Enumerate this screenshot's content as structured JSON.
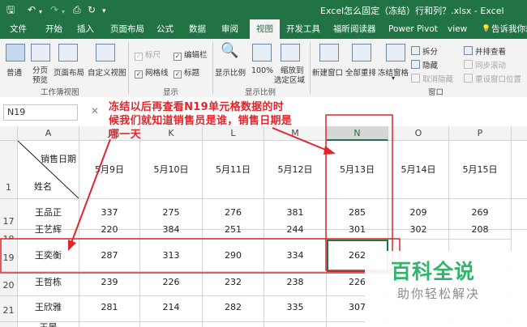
{
  "title": "Excel怎么固定（冻结）行和列？.xlsx - Excel",
  "quick_access": {
    "save_icon": "save-icon",
    "undo_icon": "undo-icon",
    "redo_icon": "redo-icon",
    "print_preview_icon": "print-preview-icon",
    "customize_icon": "customize-icon"
  },
  "tabs": [
    "文件",
    "开始",
    "插入",
    "页面布局",
    "公式",
    "数据",
    "审阅",
    "视图",
    "开发工具",
    "福昕阅读器",
    "Power Pivot",
    "view",
    "告诉我你想"
  ],
  "active_tab": "视图",
  "ribbon": {
    "workbook_views": {
      "normal": "普通",
      "page_break_1": "分页",
      "page_break_2": "预览",
      "page_layout": "页面布局",
      "custom": "自定义视图",
      "group": "工作簿视图"
    },
    "show": {
      "ruler": "标尺",
      "formula_bar": "编辑栏",
      "gridlines": "网格线",
      "headings": "标题",
      "group": "显示"
    },
    "zoom": {
      "zoom": "显示比例",
      "hundred": "100%",
      "selection_1": "缩放到",
      "selection_2": "选定区域",
      "group": "显示比例"
    },
    "window": {
      "new_window": "新建窗口",
      "arrange_all": "全部重排",
      "freeze_panes": "冻结窗格",
      "split": "拆分",
      "hide": "隐藏",
      "unhide": "取消隐藏",
      "side_by_side": "并排查看",
      "sync_scroll": "同步滚动",
      "reset_position": "重设窗口位置",
      "group": "窗口"
    }
  },
  "name_box": "N19",
  "annotation": "冻结以后再查看N19单元格数据的时候我们就知道销售员是谁，销售日期是哪一天",
  "header_cell": {
    "top": "销售日期",
    "bottom": "姓名"
  },
  "columns": [
    "A",
    "J",
    "K",
    "L",
    "M",
    "N",
    "O",
    "P"
  ],
  "dates": [
    "5月9日",
    "5月10日",
    "5月11日",
    "5月12日",
    "5月13日",
    "5月14日",
    "5月15日"
  ],
  "rows": [
    {
      "num": "1"
    },
    {
      "num": "17",
      "name": "王品正",
      "values": [
        "337",
        "275",
        "276",
        "381",
        "285",
        "209",
        "269"
      ]
    },
    {
      "num": "18",
      "name": "王艺辉",
      "values": [
        "220",
        "384",
        "251",
        "244",
        "301",
        "302",
        "208"
      ]
    },
    {
      "num": "19",
      "name": "王奕衡",
      "values": [
        "287",
        "313",
        "290",
        "334",
        "262",
        "",
        ""
      ]
    },
    {
      "num": "20",
      "name": "王哲栋",
      "values": [
        "239",
        "226",
        "232",
        "238",
        "226",
        "",
        ""
      ]
    },
    {
      "num": "21",
      "name": "王欣雅",
      "values": [
        "281",
        "214",
        "282",
        "335",
        "307",
        "",
        ""
      ]
    },
    {
      "num": "",
      "name": "王晏",
      "values": [
        "",
        "",
        "",
        "",
        "",
        "",
        ""
      ]
    }
  ],
  "watermark": {
    "brand": "百科全说",
    "slogan": "助你轻松解决"
  },
  "colors": {
    "excel_green": "#217346",
    "annotation_red": "#e0262a",
    "watermark_green": "#2fb56b"
  }
}
